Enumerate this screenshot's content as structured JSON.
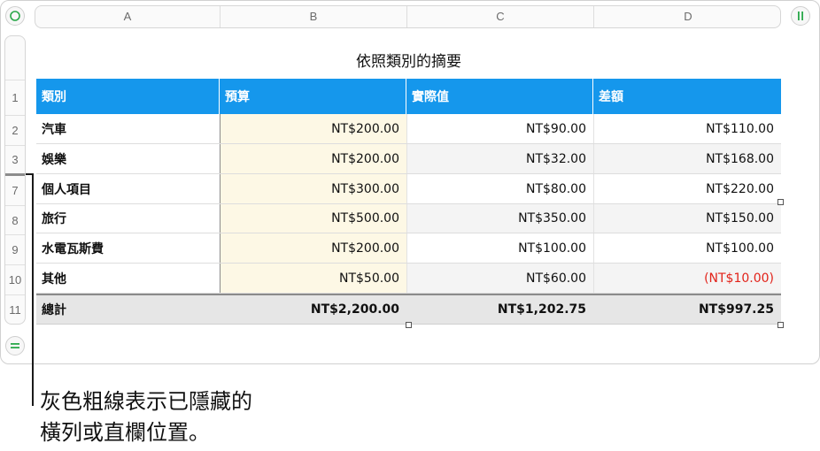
{
  "columns": [
    "A",
    "B",
    "C",
    "D"
  ],
  "rows": [
    "1",
    "2",
    "3",
    "7",
    "8",
    "9",
    "10",
    "11"
  ],
  "table": {
    "title": "依照類別的摘要",
    "headers": [
      "類別",
      "預算",
      "實際值",
      "差額"
    ],
    "body": [
      [
        "汽車",
        "NT$200.00",
        "NT$90.00",
        "NT$110.00"
      ],
      [
        "娛樂",
        "NT$200.00",
        "NT$32.00",
        "NT$168.00"
      ],
      [
        "個人項目",
        "NT$300.00",
        "NT$80.00",
        "NT$220.00"
      ],
      [
        "旅行",
        "NT$500.00",
        "NT$350.00",
        "NT$150.00"
      ],
      [
        "水電瓦斯費",
        "NT$200.00",
        "NT$100.00",
        "NT$100.00"
      ],
      [
        "其他",
        "NT$50.00",
        "NT$60.00",
        "(NT$10.00)"
      ]
    ],
    "footer": [
      "總計",
      "NT$2,200.00",
      "NT$1,202.75",
      "NT$997.25"
    ]
  },
  "icons": {
    "select_table": "circle-icon",
    "freeze_columns": "pause-bars-icon",
    "freeze_rows": "equals-icon"
  },
  "callout": {
    "line1": "灰色粗線表示已隱藏的",
    "line2": "橫列或直欄位置。"
  },
  "colors": {
    "header_bg": "#1597ec",
    "accent_green": "#2aa84a",
    "negative": "#e2231a",
    "budget_col": "#fdf8e5"
  }
}
